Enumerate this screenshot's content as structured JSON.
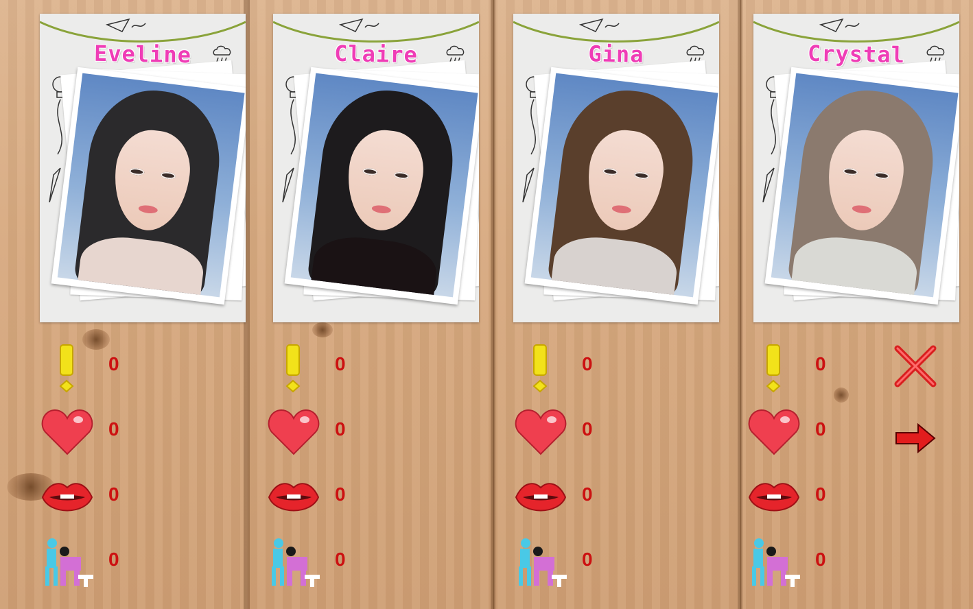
{
  "characters": [
    {
      "name": "Eveline",
      "stats": {
        "attention": "0",
        "love": "0",
        "kiss": "0",
        "sex": "0"
      },
      "hair_color": "#2b2a2c",
      "outfit_color": "#e7d6cf"
    },
    {
      "name": "Claire",
      "stats": {
        "attention": "0",
        "love": "0",
        "kiss": "0",
        "sex": "0"
      },
      "hair_color": "#1d1b1d",
      "outfit_color": "#1a1214"
    },
    {
      "name": "Gina",
      "stats": {
        "attention": "0",
        "love": "0",
        "kiss": "0",
        "sex": "0"
      },
      "hair_color": "#5a3f2c",
      "outfit_color": "#d8d2cf"
    },
    {
      "name": "Crystal",
      "stats": {
        "attention": "0",
        "love": "0",
        "kiss": "0",
        "sex": "0"
      },
      "hair_color": "#8b7a6e",
      "outfit_color": "#d9d9d4"
    }
  ],
  "icons": {
    "attention": "exclamation-icon",
    "love": "heart-icon",
    "kiss": "lips-icon",
    "sex": "couple-icon"
  },
  "colors": {
    "name_pink": "#ef3db6",
    "stat_red": "#cc1111",
    "close_red": "#d91f1f"
  }
}
